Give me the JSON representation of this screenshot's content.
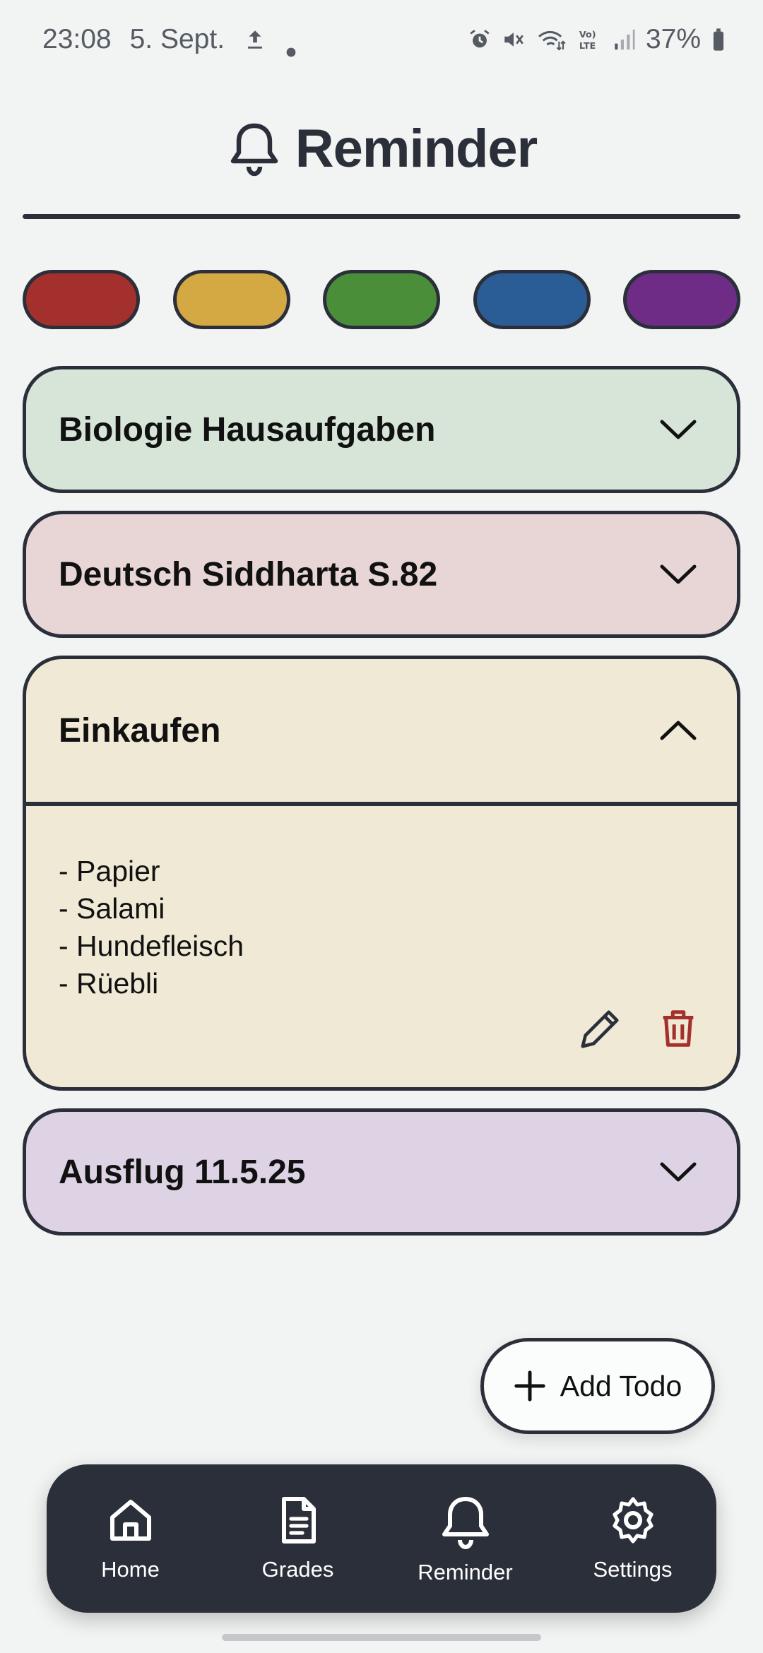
{
  "status_bar": {
    "time": "23:08",
    "date": "5. Sept.",
    "battery": "37%",
    "icons": [
      "upload-icon",
      "dot-icon",
      "alarm-icon",
      "mute-icon",
      "wifi-icon",
      "volte-icon",
      "signal-icon",
      "battery-icon"
    ]
  },
  "header": {
    "title": "Reminder",
    "icon": "bell-icon"
  },
  "color_filters": [
    {
      "name": "red",
      "color": "#a3302c"
    },
    {
      "name": "yellow",
      "color": "#d4a843"
    },
    {
      "name": "green",
      "color": "#4a8e3a"
    },
    {
      "name": "blue",
      "color": "#2a5c96"
    },
    {
      "name": "purple",
      "color": "#6e2c87"
    }
  ],
  "todos": [
    {
      "title": "Biologie Hausaufgaben",
      "color": "#d6e5d8",
      "expanded": false
    },
    {
      "title": "Deutsch Siddharta S.82",
      "color": "#e8d5d6",
      "expanded": false
    },
    {
      "title": "Einkaufen",
      "color": "#f0e9d6",
      "expanded": true,
      "lines": [
        "- Papier",
        "- Salami",
        "- Hundefleisch",
        "- Rüebli"
      ]
    },
    {
      "title": "Ausflug 11.5.25",
      "color": "#ddd3e5",
      "expanded": false
    }
  ],
  "add_todo": {
    "label": "Add Todo"
  },
  "nav": {
    "items": [
      {
        "label": "Home",
        "icon": "home-icon"
      },
      {
        "label": "Grades",
        "icon": "document-icon"
      },
      {
        "label": "Reminder",
        "icon": "bell-icon",
        "active": true
      },
      {
        "label": "Settings",
        "icon": "gear-icon"
      }
    ]
  }
}
